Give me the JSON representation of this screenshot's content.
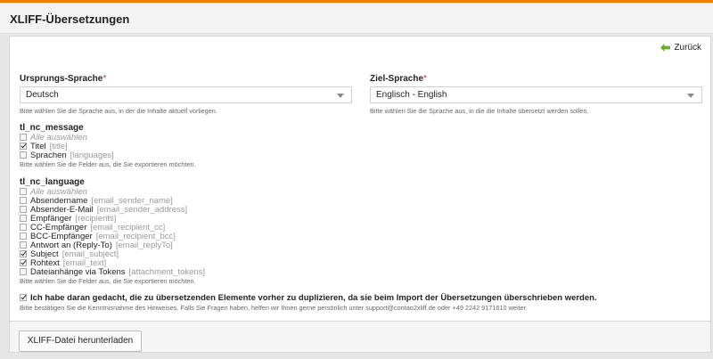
{
  "header": {
    "title": "XLIFF-Übersetzungen"
  },
  "back_link": {
    "label": "Zurück",
    "icon": "arrow-left-icon",
    "color": "#6fa832"
  },
  "source_language": {
    "label": "Ursprungs-Sprache",
    "required_mark": "*",
    "value": "Deutsch",
    "help": "Bitte wählen Sie die Sprache aus, in der die Inhalte aktuell vorliegen."
  },
  "target_language": {
    "label": "Ziel-Sprache",
    "required_mark": "*",
    "value": "Englisch - English",
    "help": "Bitte wählen Sie die Sprache aus, in die die Inhalte übersetzt werden sollen."
  },
  "groups": [
    {
      "title": "tl_nc_message",
      "select_all": "Alle auswählen",
      "items": [
        {
          "label": "Titel",
          "key": "[title]",
          "checked": true
        },
        {
          "label": "Sprachen",
          "key": "[languages]",
          "checked": false
        }
      ],
      "help": "Bitte wählen Sie die Felder aus, die Sie exportieren möchten."
    },
    {
      "title": "tl_nc_language",
      "select_all": "Alle auswählen",
      "items": [
        {
          "label": "Absendername",
          "key": "[email_sender_name]",
          "checked": false
        },
        {
          "label": "Absender-E-Mail",
          "key": "[email_sender_address]",
          "checked": false
        },
        {
          "label": "Empfänger",
          "key": "[recipients]",
          "checked": false
        },
        {
          "label": "CC-Empfänger",
          "key": "[email_recipient_cc]",
          "checked": false
        },
        {
          "label": "BCC-Empfänger",
          "key": "[email_recipient_bcc]",
          "checked": false
        },
        {
          "label": "Antwort an (Reply-To)",
          "key": "[email_replyTo]",
          "checked": false
        },
        {
          "label": "Subject",
          "key": "[email_subject]",
          "checked": true
        },
        {
          "label": "Rohtext",
          "key": "[email_text]",
          "checked": true
        },
        {
          "label": "Dateianhänge via Tokens",
          "key": "[attachment_tokens]",
          "checked": false
        }
      ],
      "help": "Bitte wählen Sie die Felder aus, die Sie exportieren möchten."
    }
  ],
  "confirm": {
    "label": "Ich habe daran gedacht, die zu übersetzenden Elemente vorher zu duplizieren, da sie beim Import der Übersetzungen überschrieben werden.",
    "checked": true,
    "help": "Bitte bestätigen Sie die Kenntnisnahme des Hinweises. Falls Sie Fragen haben, helfen wir Ihnen gerne persönlich unter support@contao2xliff.de oder +49 2242 9171610 weiter."
  },
  "footer": {
    "download_label": "XLIFF-Datei herunterladen"
  },
  "colors": {
    "accent": "#f47c00",
    "back_arrow": "#6fa832",
    "required": "#cc3333"
  }
}
